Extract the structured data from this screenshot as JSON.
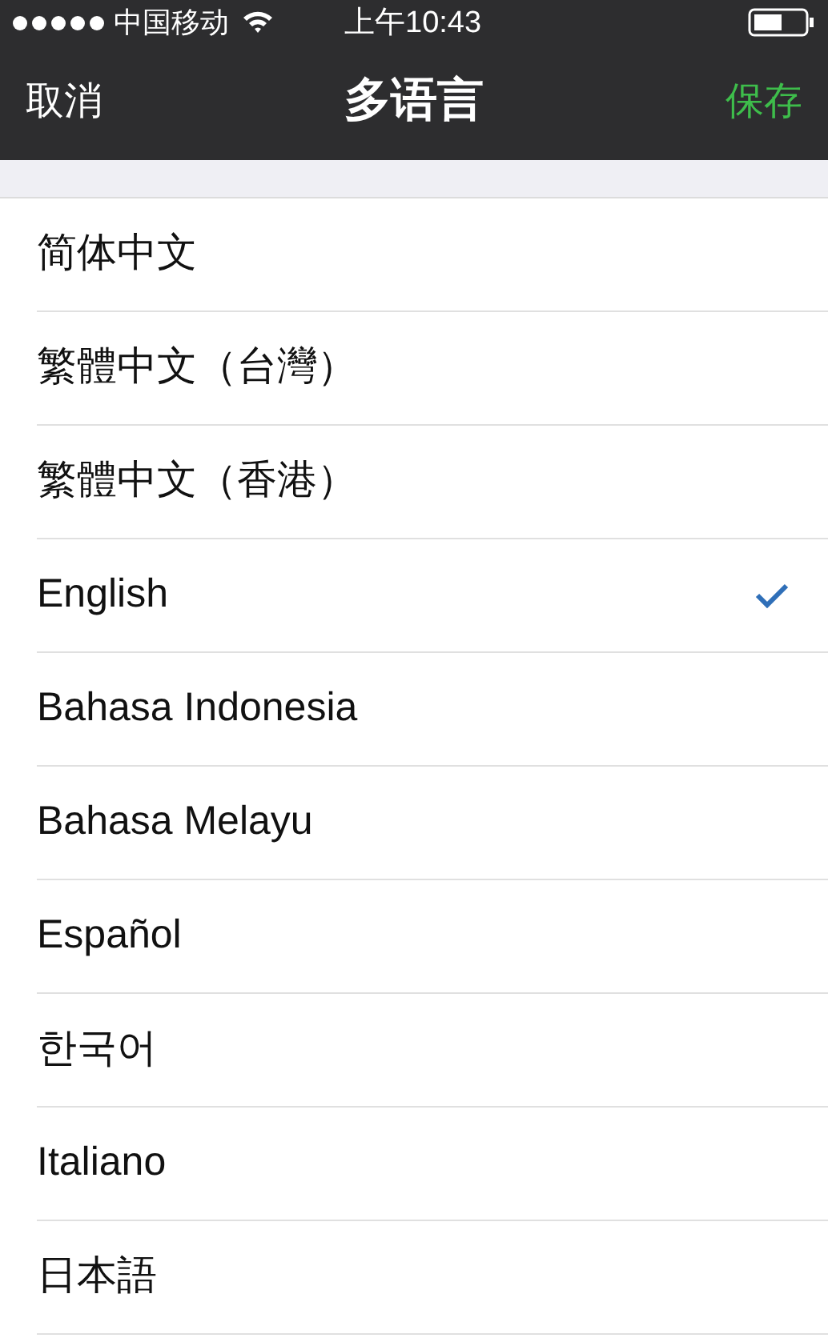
{
  "status_bar": {
    "carrier": "中国移动",
    "time": "上午10:43"
  },
  "nav_bar": {
    "cancel": "取消",
    "title": "多语言",
    "save": "保存"
  },
  "languages": [
    {
      "label": "简体中文",
      "selected": false
    },
    {
      "label": "繁體中文（台灣）",
      "selected": false
    },
    {
      "label": "繁體中文（香港）",
      "selected": false
    },
    {
      "label": "English",
      "selected": true
    },
    {
      "label": "Bahasa Indonesia",
      "selected": false
    },
    {
      "label": "Bahasa Melayu",
      "selected": false
    },
    {
      "label": "Español",
      "selected": false
    },
    {
      "label": "한국어",
      "selected": false
    },
    {
      "label": "Italiano",
      "selected": false
    },
    {
      "label": "日本語",
      "selected": false
    }
  ]
}
